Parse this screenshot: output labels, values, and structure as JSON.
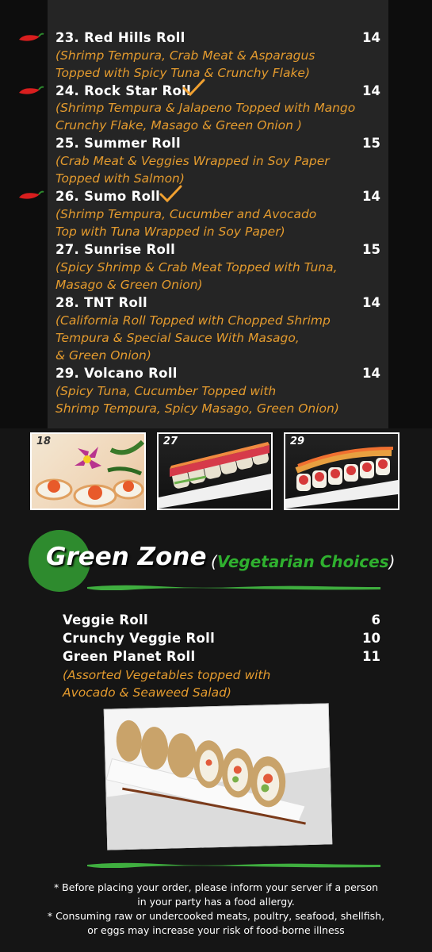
{
  "items": [
    {
      "num_name": "23. Red Hills Roll",
      "price": "14",
      "spicy": true,
      "recommended": false,
      "desc": [
        "(Shrimp Tempura, Crab Meat & Asparagus",
        "Topped with Spicy Tuna & Crunchy Flake)"
      ]
    },
    {
      "num_name": "24. Rock Star Roll",
      "price": "14",
      "spicy": true,
      "recommended": true,
      "desc": [
        "(Shrimp Tempura & Jalapeno Topped with Mango",
        "Crunchy Flake, Masago & Green Onion )"
      ]
    },
    {
      "num_name": "25. Summer Roll",
      "price": "15",
      "spicy": false,
      "recommended": false,
      "desc": [
        "(Crab Meat & Veggies Wrapped in Soy Paper",
        "Topped with Salmon)"
      ]
    },
    {
      "num_name": "26. Sumo Roll",
      "price": "14",
      "spicy": true,
      "recommended": true,
      "desc": [
        "(Shrimp Tempura, Cucumber and Avocado",
        "Top with Tuna Wrapped in Soy Paper)"
      ]
    },
    {
      "num_name": "27. Sunrise Roll",
      "price": "15",
      "spicy": false,
      "recommended": false,
      "desc": [
        "(Spicy Shrimp & Crab Meat Topped with Tuna,",
        "Masago & Green Onion)"
      ]
    },
    {
      "num_name": "28. TNT Roll",
      "price": "14",
      "spicy": false,
      "recommended": false,
      "desc": [
        "(California Roll Topped with Chopped Shrimp",
        "Tempura & Special Sauce With Masago,",
        "& Green Onion)"
      ]
    },
    {
      "num_name": "29. Volcano Roll",
      "price": "14",
      "spicy": false,
      "recommended": false,
      "desc": [
        "(Spicy Tuna, Cucumber Topped with",
        "Shrimp Tempura, Spicy Masago, Green Onion)"
      ]
    }
  ],
  "photos": [
    {
      "number": "18"
    },
    {
      "number": "27"
    },
    {
      "number": "29"
    }
  ],
  "green_zone": {
    "title": "Green Zone",
    "open_paren": "(",
    "subtitle": "Vegetarian Choices",
    "close_paren": ")"
  },
  "veggie_items": [
    {
      "name": "Veggie Roll",
      "price": "6"
    },
    {
      "name": "Crunchy Veggie Roll",
      "price": "10"
    },
    {
      "name": "Green Planet Roll",
      "price": "11"
    }
  ],
  "veggie_desc": [
    "(Assorted Vegetables topped with",
    "Avocado & Seaweed Salad)"
  ],
  "notes": [
    "*  Before placing your order, please inform your server if a person",
    "in your party has a food allergy.",
    "* Consuming raw or undercooked meats, poultry, seafood, shellfish,",
    "or eggs may increase your risk of food-borne illness"
  ],
  "colors": {
    "description": "#e49b2e",
    "accent_green": "#2fb02f",
    "check": "#f0a030",
    "chili": "#d81e1e"
  }
}
